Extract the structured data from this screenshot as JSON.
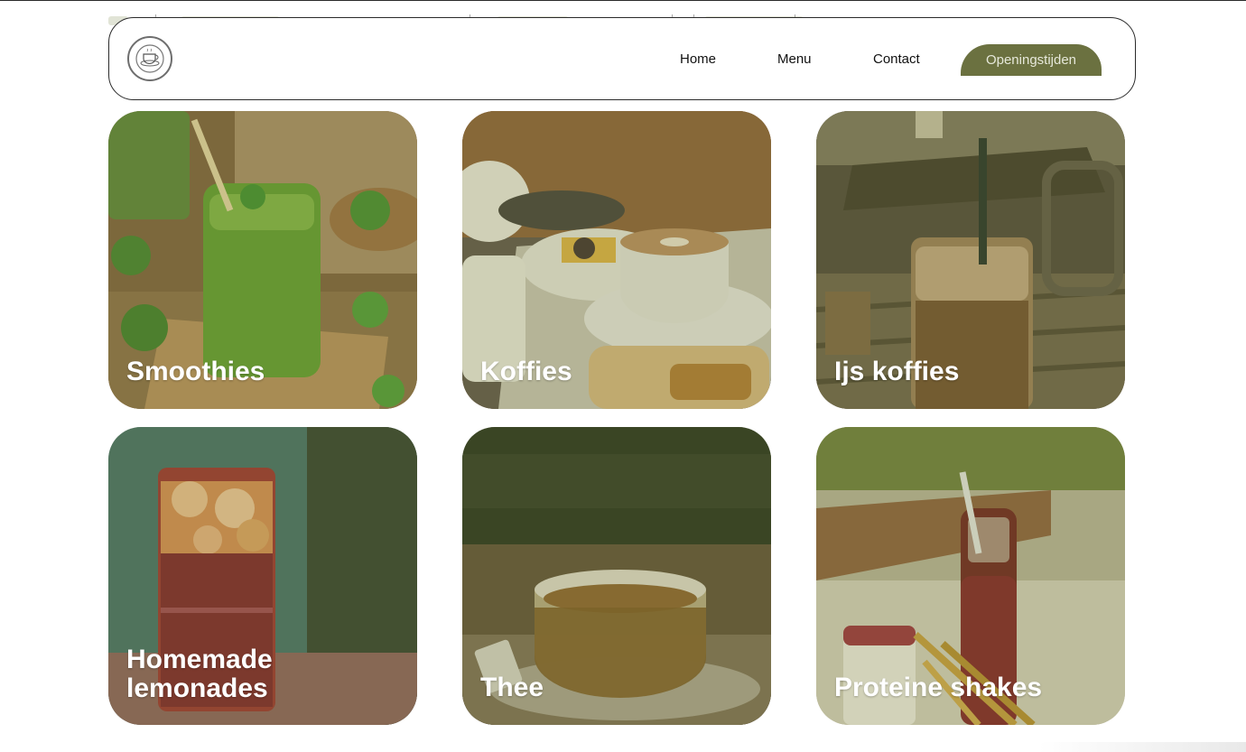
{
  "nav": {
    "logo_icon": "coffee-cup-logo-icon",
    "links": [
      "Home",
      "Menu",
      "Contact"
    ],
    "cta_label": "Openingstijden"
  },
  "colors": {
    "accent": "#6b7140",
    "cta_text": "#e6e8da",
    "card_label": "#ffffff",
    "border": "#2b2b2b"
  },
  "cards": [
    {
      "label": "Smoothies",
      "image": "green-smoothie-photo"
    },
    {
      "label": "Koffies",
      "image": "cappuccino-photo"
    },
    {
      "label": "Ijs koffies",
      "image": "iced-coffee-photo"
    },
    {
      "label": "Homemade lemonades",
      "image": "red-lemonade-photo"
    },
    {
      "label": "Thee",
      "image": "tea-cup-photo"
    },
    {
      "label": "Proteine shakes",
      "image": "protein-shake-bottle-photo"
    }
  ]
}
